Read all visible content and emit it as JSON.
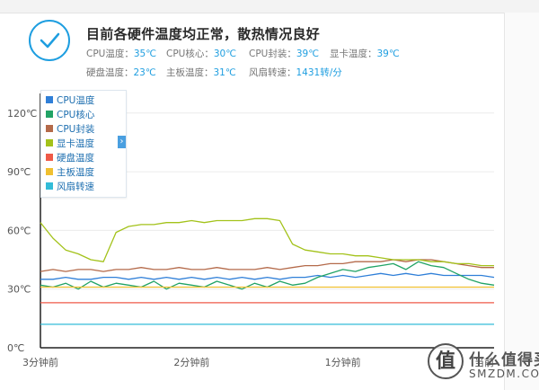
{
  "status": {
    "headline": "目前各硬件温度均正常，散热情况良好",
    "icon": "checkmark-icon",
    "row1": [
      {
        "label": "CPU温度：",
        "value": "35℃"
      },
      {
        "label": "CPU核心：",
        "value": "30℃"
      },
      {
        "label": "CPU封装：",
        "value": "39℃"
      },
      {
        "label": "显卡温度：",
        "value": "39℃"
      }
    ],
    "row2": [
      {
        "label": "硬盘温度：",
        "value": "23℃"
      },
      {
        "label": "主板温度：",
        "value": "31℃"
      },
      {
        "label": "风扇转速：",
        "value": "1431转/分"
      }
    ]
  },
  "colors": {
    "accent": "#1e9ee0"
  },
  "legend_toggle": "›",
  "chart_data": {
    "type": "line",
    "y_tick_labels": [
      "0℃",
      "30℃",
      "60℃",
      "90℃",
      "120℃"
    ],
    "y_ticks": [
      0,
      30,
      60,
      90,
      120
    ],
    "ylim": [
      0,
      130
    ],
    "x_tick_labels": [
      "3分钟前",
      "2分钟前",
      "1分钟前",
      "当前"
    ],
    "x_ticks": [
      180,
      120,
      60,
      0
    ],
    "x_unit": "seconds ago",
    "xlim": [
      180,
      0
    ],
    "grid": true,
    "legend_position": "top-left",
    "x": [
      180,
      175,
      170,
      165,
      160,
      155,
      150,
      145,
      140,
      135,
      130,
      125,
      120,
      115,
      110,
      105,
      100,
      95,
      90,
      85,
      80,
      75,
      70,
      65,
      60,
      55,
      50,
      45,
      40,
      35,
      30,
      25,
      20,
      15,
      10,
      5,
      0
    ],
    "series": [
      {
        "name": "CPU温度",
        "color": "#2f7fd8",
        "values": [
          35,
          35,
          36,
          35,
          35,
          36,
          36,
          35,
          36,
          35,
          36,
          35,
          36,
          35,
          36,
          35,
          36,
          35,
          36,
          35,
          36,
          36,
          37,
          36,
          37,
          36,
          37,
          38,
          37,
          38,
          37,
          38,
          37,
          37,
          37,
          37,
          36
        ]
      },
      {
        "name": "CPU核心",
        "color": "#21a366",
        "values": [
          32,
          31,
          33,
          30,
          34,
          31,
          33,
          32,
          31,
          34,
          30,
          33,
          32,
          31,
          34,
          32,
          30,
          33,
          31,
          34,
          32,
          33,
          36,
          38,
          40,
          39,
          41,
          42,
          43,
          40,
          44,
          42,
          41,
          38,
          35,
          33,
          32
        ]
      },
      {
        "name": "CPU封装",
        "color": "#b46a4a",
        "values": [
          39,
          40,
          39,
          40,
          40,
          39,
          40,
          40,
          41,
          40,
          40,
          41,
          40,
          40,
          41,
          40,
          40,
          40,
          41,
          40,
          41,
          42,
          42,
          43,
          43,
          44,
          44,
          44,
          45,
          44,
          45,
          45,
          44,
          43,
          42,
          41,
          41
        ]
      },
      {
        "name": "显卡温度",
        "color": "#a3c21a",
        "values": [
          64,
          56,
          50,
          48,
          45,
          44,
          59,
          62,
          63,
          63,
          64,
          64,
          65,
          64,
          65,
          65,
          65,
          66,
          66,
          65,
          53,
          50,
          49,
          48,
          48,
          47,
          47,
          46,
          45,
          45,
          45,
          44,
          44,
          43,
          43,
          42,
          42
        ]
      },
      {
        "name": "硬盘温度",
        "color": "#ef5a48",
        "values": [
          23,
          23,
          23,
          23,
          23,
          23,
          23,
          23,
          23,
          23,
          23,
          23,
          23,
          23,
          23,
          23,
          23,
          23,
          23,
          23,
          23,
          23,
          23,
          23,
          23,
          23,
          23,
          23,
          23,
          23,
          23,
          23,
          23,
          23,
          23,
          23,
          23
        ]
      },
      {
        "name": "主板温度",
        "color": "#f0c030",
        "values": [
          31,
          31,
          31,
          31,
          31,
          31,
          31,
          31,
          31,
          31,
          31,
          31,
          31,
          31,
          31,
          31,
          31,
          31,
          31,
          31,
          31,
          31,
          31,
          31,
          31,
          31,
          31,
          31,
          31,
          31,
          31,
          31,
          31,
          31,
          31,
          31,
          31
        ]
      },
      {
        "name": "风扇转速",
        "color": "#32bcd8",
        "values": [
          12,
          12,
          12,
          12,
          12,
          12,
          12,
          12,
          12,
          12,
          12,
          12,
          12,
          12,
          12,
          12,
          12,
          12,
          12,
          12,
          12,
          12,
          12,
          12,
          12,
          12,
          12,
          12,
          12,
          12,
          12,
          12,
          12,
          12,
          12,
          12,
          12
        ]
      }
    ]
  },
  "watermark": {
    "logo_char": "值",
    "text": "什么值得买",
    "sub": "SMZDM.COM"
  }
}
